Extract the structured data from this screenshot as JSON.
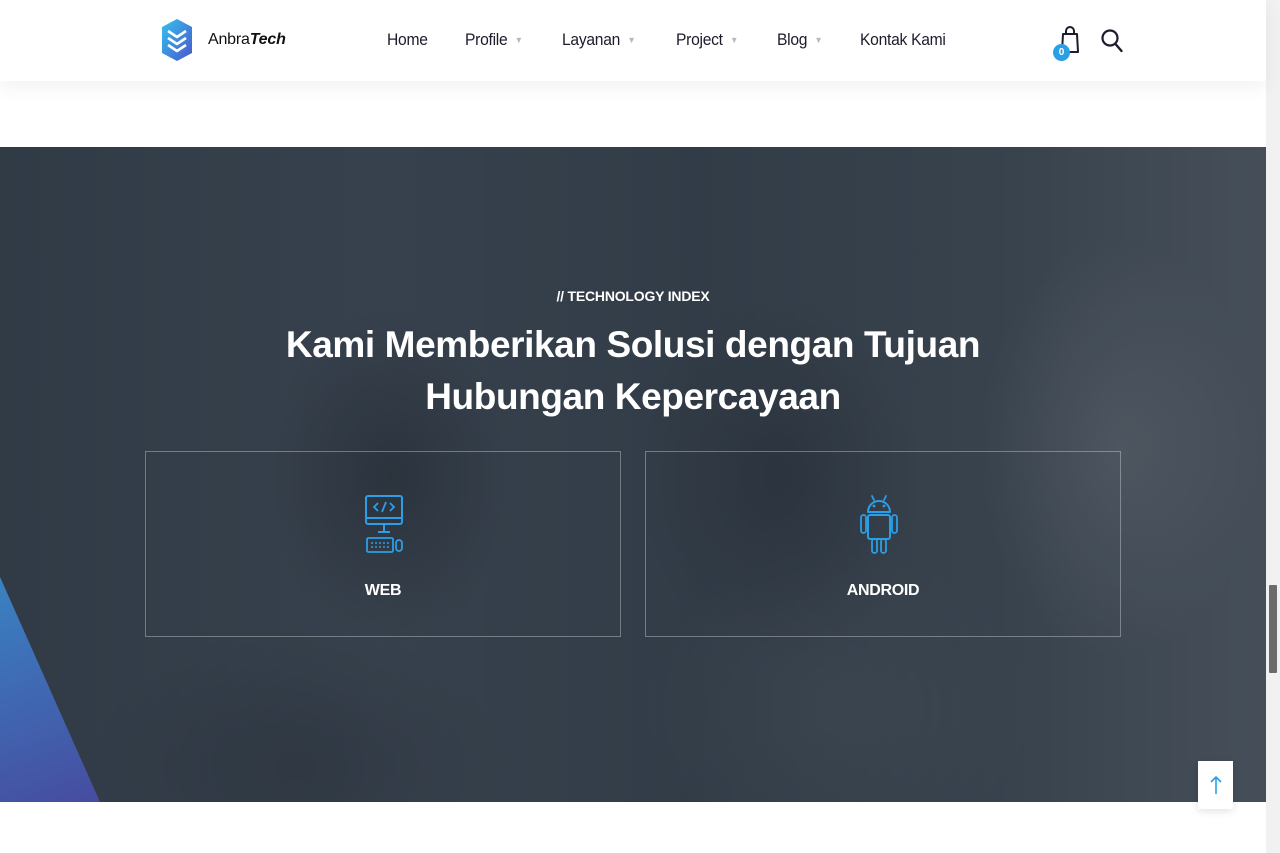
{
  "brand": {
    "name_regular": "Anbra",
    "name_bold": "Tech",
    "accent_color": "#2b9fe6"
  },
  "nav": {
    "home": "Home",
    "profile": "Profile",
    "layanan": "Layanan",
    "project": "Project",
    "blog": "Blog",
    "kontak": "Kontak Kami",
    "caret_glyph": "▼"
  },
  "header_actions": {
    "cart_icon": "shopping-bag-icon",
    "cart_count": "0",
    "search_icon": "search-icon"
  },
  "hero": {
    "subtitle": "// TECHNOLOGY INDEX",
    "title": "Kami Memberikan Solusi dengan Tujuan Hubungan Kepercayaan",
    "cards": [
      {
        "label": "WEB",
        "icon": "web-development-icon"
      },
      {
        "label": "ANDROID",
        "icon": "android-icon"
      }
    ]
  },
  "back_to_top": {
    "icon": "arrow-up-icon"
  }
}
